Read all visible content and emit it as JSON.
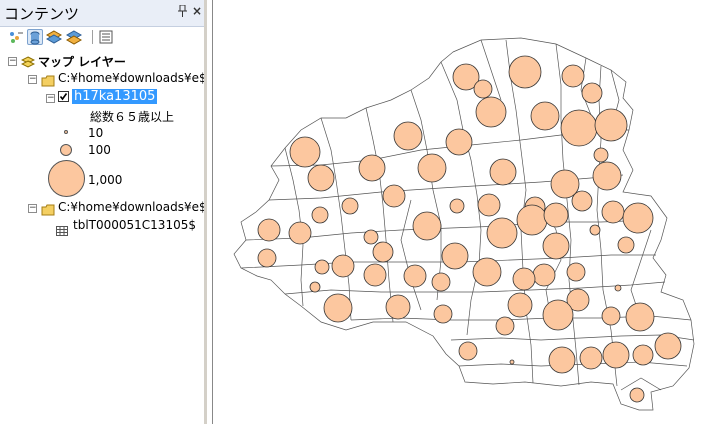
{
  "toc": {
    "title": "コンテンツ",
    "pin_glyph": "ᵖ",
    "close_glyph": "×",
    "toolbar": [
      "list-by-drawing-order-icon",
      "list-by-source-icon",
      "list-by-visibility-icon",
      "list-by-selection-icon",
      "options-icon"
    ],
    "map_layer_label": "マップ レイヤー",
    "folder1_label": "C:¥home¥downloads¥e$",
    "layer_label": "h17ka13105",
    "field_label": "総数６５歳以上",
    "legend": [
      {
        "label": "10",
        "value": 10
      },
      {
        "label": "100",
        "value": 100
      },
      {
        "label": "1,000",
        "value": 1000
      }
    ],
    "folder2_label": "C:¥home¥downloads¥e$",
    "table_label": "tblT000051C13105$"
  },
  "colors": {
    "symbol_fill": "#fcc79f",
    "symbol_stroke": "#333333",
    "selection": "#3399ff"
  },
  "map": {
    "symbols": [
      [
        465,
        77,
        13
      ],
      [
        524,
        72,
        16
      ],
      [
        572,
        76,
        11
      ],
      [
        482,
        89,
        9
      ],
      [
        490,
        112,
        15
      ],
      [
        544,
        116,
        14
      ],
      [
        578,
        128,
        18
      ],
      [
        610,
        125,
        16
      ],
      [
        591,
        93,
        10
      ],
      [
        407,
        136,
        14
      ],
      [
        458,
        142,
        13
      ],
      [
        304,
        152,
        15
      ],
      [
        371,
        168,
        13
      ],
      [
        431,
        168,
        14
      ],
      [
        502,
        172,
        13
      ],
      [
        320,
        178,
        13
      ],
      [
        600,
        155,
        7
      ],
      [
        564,
        184,
        14
      ],
      [
        606,
        176,
        14
      ],
      [
        534,
        207,
        10
      ],
      [
        393,
        196,
        11
      ],
      [
        268,
        230,
        11
      ],
      [
        456,
        206,
        7
      ],
      [
        488,
        205,
        11
      ],
      [
        349,
        206,
        8
      ],
      [
        319,
        215,
        8
      ],
      [
        426,
        226,
        14
      ],
      [
        299,
        233,
        11
      ],
      [
        531,
        220,
        15
      ],
      [
        555,
        215,
        12
      ],
      [
        612,
        212,
        11
      ],
      [
        637,
        218,
        15
      ],
      [
        581,
        201,
        10
      ],
      [
        370,
        237,
        7
      ],
      [
        501,
        233,
        15
      ],
      [
        555,
        246,
        13
      ],
      [
        382,
        252,
        10
      ],
      [
        594,
        230,
        5
      ],
      [
        454,
        256,
        13
      ],
      [
        625,
        245,
        8
      ],
      [
        266,
        258,
        9
      ],
      [
        321,
        267,
        7
      ],
      [
        342,
        266,
        11
      ],
      [
        486,
        272,
        14
      ],
      [
        543,
        275,
        11
      ],
      [
        575,
        272,
        9
      ],
      [
        414,
        276,
        11
      ],
      [
        440,
        282,
        9
      ],
      [
        374,
        275,
        11
      ],
      [
        523,
        279,
        11
      ],
      [
        314,
        287,
        5
      ],
      [
        617,
        288,
        3
      ],
      [
        519,
        305,
        12
      ],
      [
        577,
        300,
        11
      ],
      [
        337,
        308,
        14
      ],
      [
        397,
        307,
        12
      ],
      [
        557,
        315,
        15
      ],
      [
        504,
        326,
        9
      ],
      [
        442,
        314,
        9
      ],
      [
        610,
        316,
        9
      ],
      [
        639,
        317,
        14
      ],
      [
        467,
        351,
        9
      ],
      [
        511,
        362,
        2
      ],
      [
        561,
        360,
        13
      ],
      [
        615,
        355,
        13
      ],
      [
        642,
        355,
        10
      ],
      [
        667,
        346,
        13
      ],
      [
        590,
        358,
        11
      ],
      [
        636,
        395,
        7
      ]
    ]
  }
}
